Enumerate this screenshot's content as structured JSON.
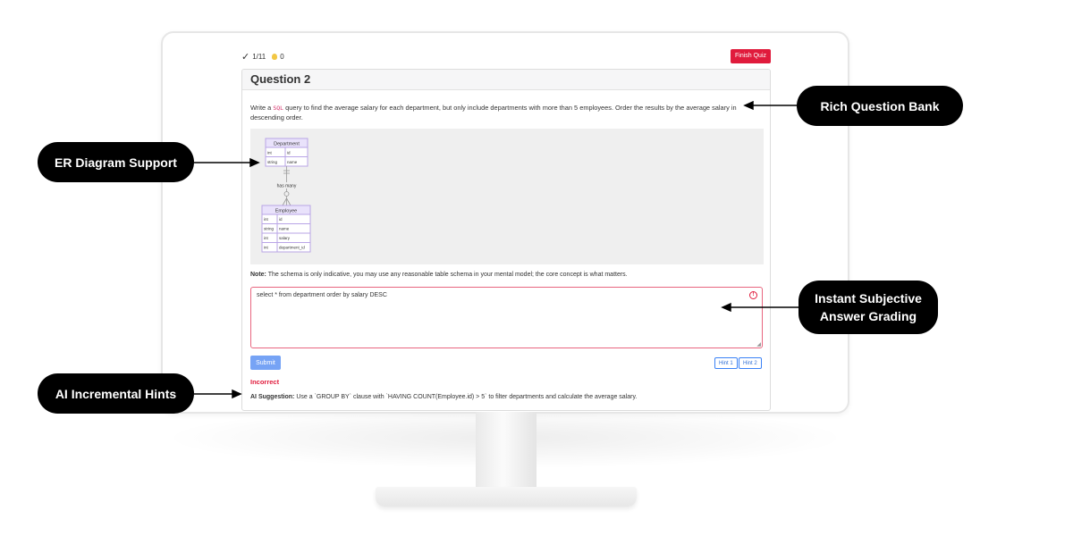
{
  "quiz": {
    "progress": "1/11",
    "hints_used": "0",
    "finish_label": "Finish Quiz"
  },
  "question": {
    "title": "Question 2",
    "text_before": "Write a ",
    "sql_tag": "SQL",
    "text_after": " query to find the average salary for each department, but only include departments with more than 5 employees. Order the results by the average salary in descending order.",
    "note_label": "Note:",
    "note_text": " The schema is only indicative, you may use any reasonable table schema in your mental model; the core concept is what matters."
  },
  "diagram": {
    "relation": "has many",
    "entities": [
      {
        "name": "Department",
        "fields": [
          [
            "int",
            "id"
          ],
          [
            "string",
            "name"
          ]
        ]
      },
      {
        "name": "Employee",
        "fields": [
          [
            "int",
            "id"
          ],
          [
            "string",
            "name"
          ],
          [
            "int",
            "salary"
          ],
          [
            "int",
            "department_id"
          ]
        ]
      }
    ],
    "colors": {
      "border": "#b9a5e6",
      "header": "#e9e2fb",
      "line": "#999999"
    }
  },
  "answer": {
    "value": "select * from department order by salary DESC"
  },
  "actions": {
    "submit_label": "Submit",
    "hint1_label": "Hint 1",
    "hint2_label": "Hint 2"
  },
  "result": {
    "status": "Incorrect",
    "suggestion_label": "AI Suggestion:",
    "suggestion_text": " Use a `GROUP BY` clause with `HAVING COUNT(Employee.id) > 5` to filter departments and calculate the average salary."
  },
  "callouts": {
    "question_bank": "Rich Question Bank",
    "er_diagram": "ER Diagram Support",
    "grading_line1": "Instant Subjective",
    "grading_line2": "Answer Grading",
    "hints": "AI Incremental Hints"
  },
  "colors": {
    "accent_red": "#e01b3c",
    "accent_blue": "#3b82f6",
    "callout_bg": "#000000"
  }
}
